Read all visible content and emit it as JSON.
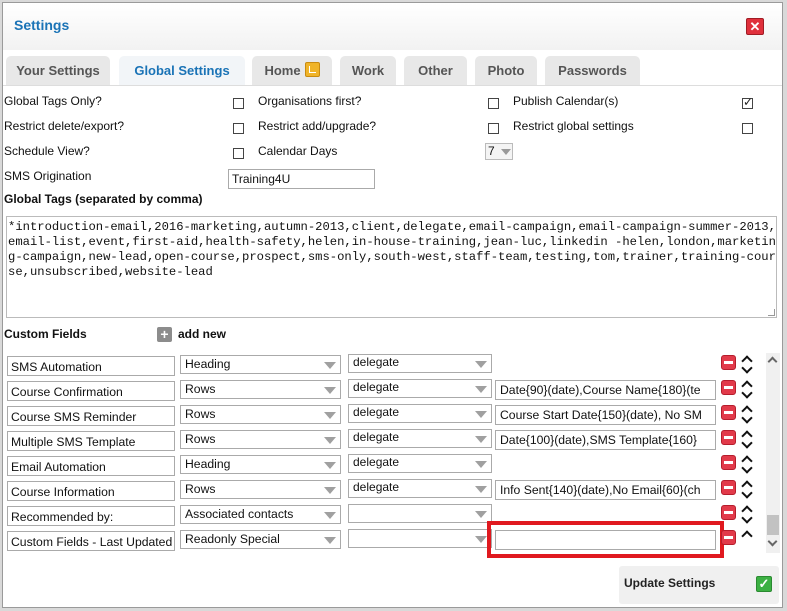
{
  "dialog": {
    "title": "Settings",
    "close_icon": "close-icon"
  },
  "tabs": [
    {
      "label": "Your Settings",
      "active": false
    },
    {
      "label": "Global Settings",
      "active": true
    },
    {
      "label": "Home",
      "active": false,
      "icon": "edit-icon"
    },
    {
      "label": "Work",
      "active": false
    },
    {
      "label": "Other",
      "active": false
    },
    {
      "label": "Photo",
      "active": false
    },
    {
      "label": "Passwords",
      "active": false
    }
  ],
  "options": {
    "global_tags_only": {
      "label": "Global Tags Only?",
      "checked": false
    },
    "organisations_first": {
      "label": "Organisations first?",
      "checked": false
    },
    "publish_calendar": {
      "label": "Publish Calendar(s)",
      "checked": true
    },
    "restrict_delete_export": {
      "label": "Restrict delete/export?",
      "checked": false
    },
    "restrict_add_upgrade": {
      "label": "Restrict add/upgrade?",
      "checked": false
    },
    "restrict_global_settings": {
      "label": "Restrict global settings",
      "checked": false
    },
    "schedule_view": {
      "label": "Schedule View?",
      "checked": false
    },
    "calendar_days": {
      "label": "Calendar Days",
      "value": "7"
    },
    "sms_origination": {
      "label": "SMS Origination",
      "value": "Training4U"
    }
  },
  "global_tags": {
    "label": "Global Tags (separated by comma)",
    "value": "*introduction-email,2016-marketing,autumn-2013,client,delegate,email-campaign,email-campaign-summer-2013,email-list,event,first-aid,health-safety,helen,in-house-training,jean-luc,linkedin -helen,london,marketing-campaign,new-lead,open-course,prospect,sms-only,south-west,staff-team,testing,tom,trainer,training-course,unsubscribed,website-lead"
  },
  "custom_fields": {
    "label": "Custom Fields",
    "add_label": "add new",
    "rows": [
      {
        "name": "SMS Automation",
        "type": "Heading",
        "scope": "delegate",
        "options": "",
        "has_options": false,
        "up": true,
        "down": true
      },
      {
        "name": "Course Confirmation",
        "type": "Rows",
        "scope": "delegate",
        "options": "Date{90}(date),Course Name{180}(te",
        "has_options": true,
        "up": true,
        "down": true
      },
      {
        "name": "Course SMS Reminder",
        "type": "Rows",
        "scope": "delegate",
        "options": "Course Start Date{150}(date), No SM",
        "has_options": true,
        "up": true,
        "down": true
      },
      {
        "name": "Multiple SMS Template",
        "type": "Rows",
        "scope": "delegate",
        "options": "Date{100}(date),SMS Template{160}",
        "has_options": true,
        "up": true,
        "down": true
      },
      {
        "name": "Email Automation",
        "type": "Heading",
        "scope": "delegate",
        "options": "",
        "has_options": false,
        "up": true,
        "down": true
      },
      {
        "name": "Course Information",
        "type": "Rows",
        "scope": "delegate",
        "options": "Info Sent{140}(date),No Email{60}(ch",
        "has_options": true,
        "up": true,
        "down": true
      },
      {
        "name": "Recommended by:",
        "type": "Associated contacts",
        "scope": "",
        "options": "",
        "has_options": false,
        "up": true,
        "down": true
      },
      {
        "name": "Custom Fields - Last Updated",
        "type": "Readonly Special",
        "scope": "",
        "options": "",
        "has_options": true,
        "up": true,
        "down": false
      }
    ]
  },
  "footer": {
    "update_label": "Update Settings",
    "update_icon": "check-icon"
  },
  "colors": {
    "accent": "#1a73b6",
    "danger": "#e23a4a",
    "success": "#3cb043",
    "highlight": "#e0191f"
  }
}
